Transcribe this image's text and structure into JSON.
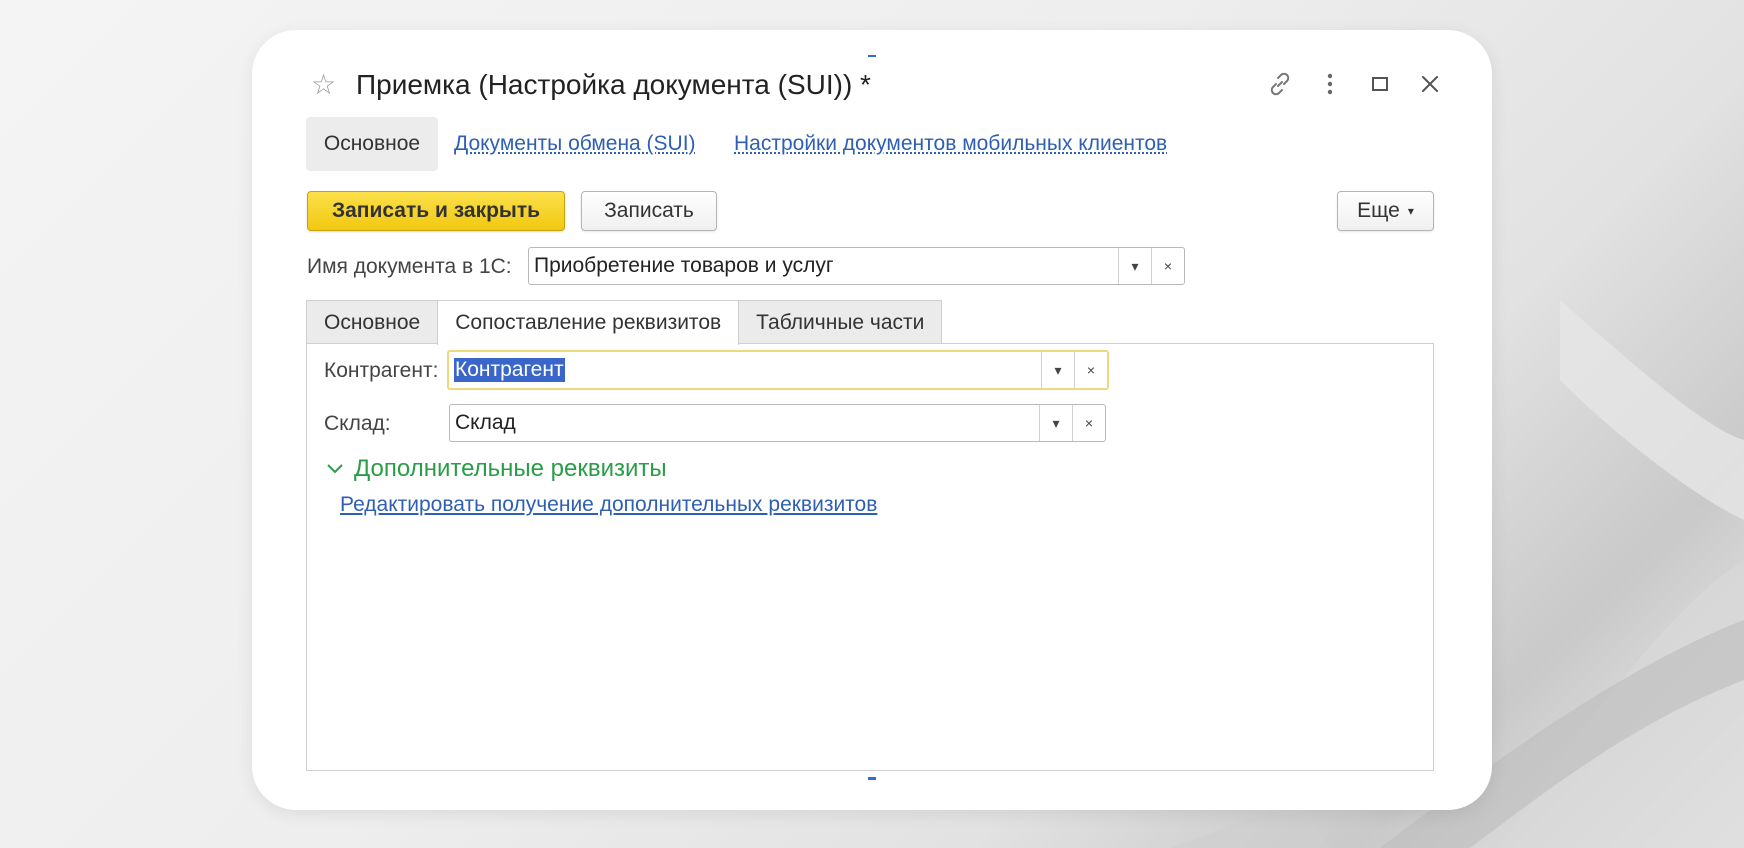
{
  "window": {
    "title": "Приемка (Настройка документа (SUI)) *",
    "star_icon": "star-outline-icon",
    "controls": [
      "link-icon",
      "more-vertical-icon",
      "maximize-icon",
      "close-icon"
    ]
  },
  "nav": {
    "current": "Основное",
    "links": [
      "Документы обмена (SUI)",
      "Настройки документов мобильных клиентов"
    ]
  },
  "toolbar": {
    "save_close": "Записать и закрыть",
    "save": "Записать",
    "more": "Еще",
    "more_caret": "▾"
  },
  "doc_name": {
    "label": "Имя документа в 1С:",
    "value": "Приобретение товаров и услуг"
  },
  "tabs": [
    {
      "label": "Основное",
      "active": false
    },
    {
      "label": "Сопоставление реквизитов",
      "active": true
    },
    {
      "label": "Табличные части",
      "active": false
    }
  ],
  "fields": {
    "counterparty": {
      "label": "Контрагент:",
      "value": "Контрагент"
    },
    "warehouse": {
      "label": "Склад:",
      "value": "Склад"
    }
  },
  "field_buttons": {
    "dropdown": "▾",
    "clear": "×"
  },
  "additional": {
    "header": "Дополнительные реквизиты",
    "link": "Редактировать получение дополнительных реквизитов"
  },
  "colors": {
    "accent_yellow": "#f2c811",
    "link_blue": "#2f5fb3",
    "group_green": "#2a9d48",
    "selection_blue": "#3a66c9",
    "focus_border": "#f0d77a"
  }
}
